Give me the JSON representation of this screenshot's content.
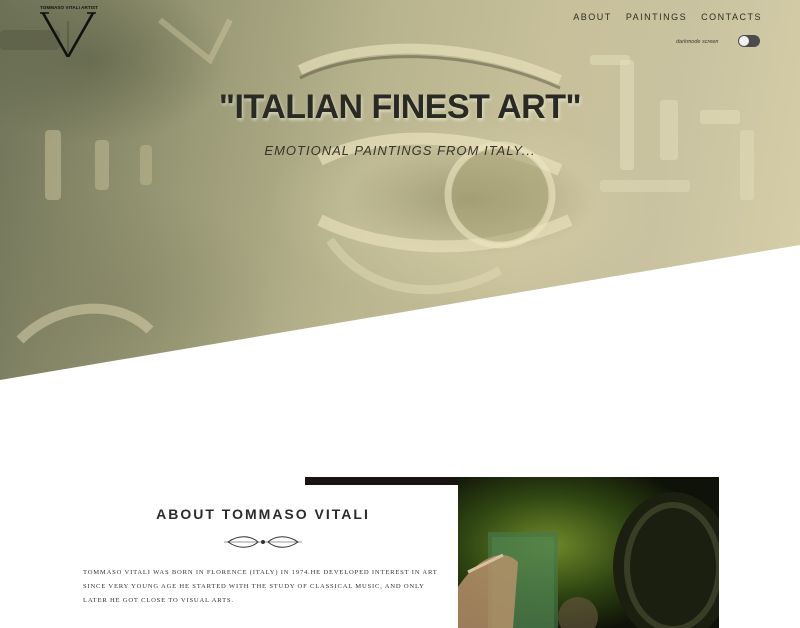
{
  "logo": {
    "text": "TOMMASO VITALI ARTIST",
    "letter": "V"
  },
  "nav": {
    "items": [
      "ABOUT",
      "PAINTINGS",
      "CONTACTS"
    ]
  },
  "darkmode": {
    "label": "darkmode screen",
    "enabled": false
  },
  "hero": {
    "title": "\"ITALIAN FINEST ART\"",
    "subtitle": "EMOTIONAL PAINTINGS FROM ITALY..."
  },
  "about": {
    "title": "ABOUT TOMMASO VITALI",
    "text": "Tommaso Vitali was born in Florence (Italy) in 1974.He developed interest in art since very young age he started with the study of classical music, and only later he got close to visual arts."
  },
  "colors": {
    "hero_tint": "#c9c2a0",
    "dark": "#1a1410",
    "toggle": "#4c4c4c"
  }
}
